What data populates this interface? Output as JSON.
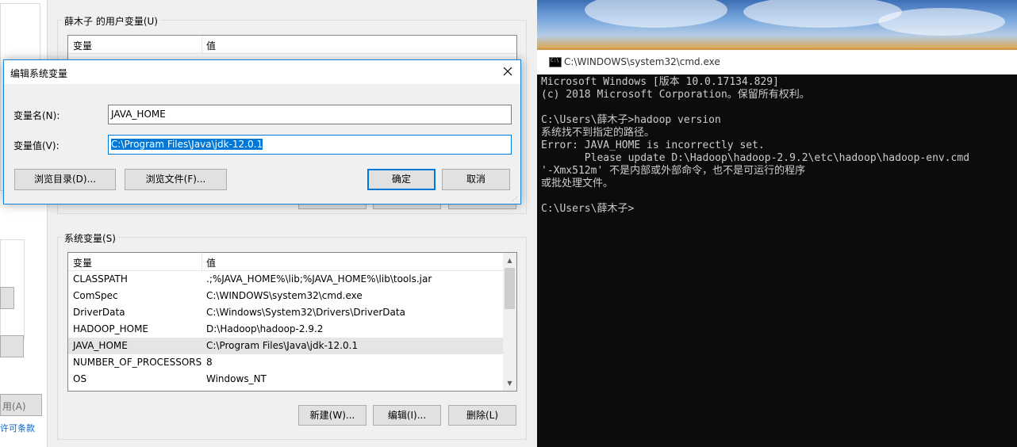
{
  "left_window": {
    "apply_button": "用(A)",
    "link_text": "许可条款"
  },
  "env_window": {
    "user_vars_group": "薛木子 的用户变量(U)",
    "user_vars_columns": [
      "变量",
      "值"
    ],
    "system_vars_group": "系统变量(S)",
    "system_vars_columns": [
      "变量",
      "值"
    ],
    "system_vars_rows": [
      {
        "name": "CLASSPATH",
        "value": ".;%JAVA_HOME%\\lib;%JAVA_HOME%\\lib\\tools.jar"
      },
      {
        "name": "ComSpec",
        "value": "C:\\WINDOWS\\system32\\cmd.exe"
      },
      {
        "name": "DriverData",
        "value": "C:\\Windows\\System32\\Drivers\\DriverData"
      },
      {
        "name": "HADOOP_HOME",
        "value": "D:\\Hadoop\\hadoop-2.9.2"
      },
      {
        "name": "JAVA_HOME",
        "value": "C:\\Program Files\\Java\\jdk-12.0.1"
      },
      {
        "name": "NUMBER_OF_PROCESSORS",
        "value": "8"
      },
      {
        "name": "OS",
        "value": "Windows_NT"
      }
    ],
    "selected_row": "JAVA_HOME",
    "buttons": {
      "new": "新建(W)...",
      "edit": "编辑(I)...",
      "delete": "删除(L)"
    }
  },
  "dialog": {
    "title": "编辑系统变量",
    "name_label": "变量名(N):",
    "name_value": "JAVA_HOME",
    "value_label": "变量值(V):",
    "value_value": "C:\\Program Files\\Java\\jdk-12.0.1",
    "browse_dir": "浏览目录(D)...",
    "browse_file": "浏览文件(F)...",
    "ok": "确定",
    "cancel": "取消",
    "close_icon": "close-icon"
  },
  "cmd": {
    "title": "C:\\WINDOWS\\system32\\cmd.exe",
    "icon_text": "C:\\",
    "lines": [
      "Microsoft Windows [版本 10.0.17134.829]",
      "(c) 2018 Microsoft Corporation。保留所有权利。",
      "",
      "C:\\Users\\薛木子>hadoop version",
      "系统找不到指定的路径。",
      "Error: JAVA_HOME is incorrectly set.",
      "       Please update D:\\Hadoop\\hadoop-2.9.2\\etc\\hadoop\\hadoop-env.cmd",
      "'-Xmx512m' 不是内部或外部命令，也不是可运行的程序",
      "或批处理文件。",
      "",
      "C:\\Users\\薛木子>"
    ]
  },
  "colors": {
    "accent": "#0078d7",
    "console_bg": "#0c0c0c",
    "console_fg": "#cccccc"
  }
}
